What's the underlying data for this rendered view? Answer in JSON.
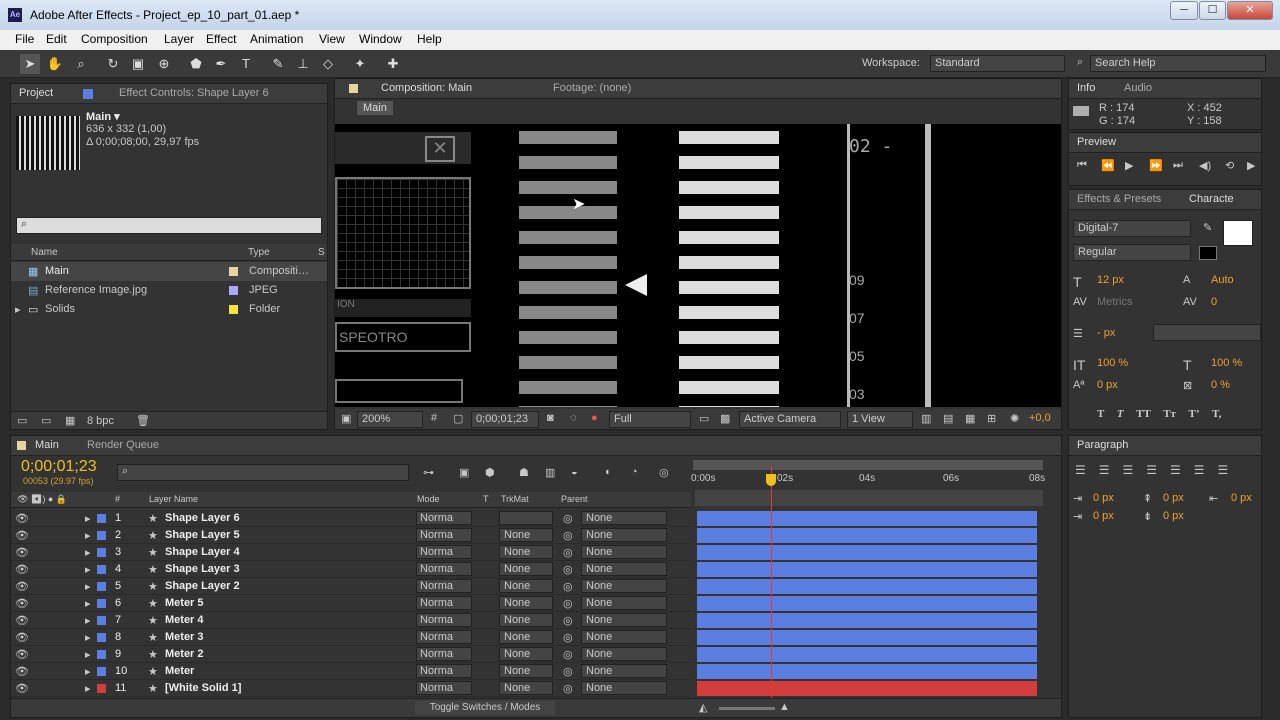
{
  "window": {
    "title": "Adobe After Effects - Project_ep_10_part_01.aep *",
    "app_icon": "Ae",
    "minimize": "─",
    "maximize": "☐",
    "close": "✕"
  },
  "menu": [
    "File",
    "Edit",
    "Composition",
    "Layer",
    "Effect",
    "Animation",
    "View",
    "Window",
    "Help"
  ],
  "toolbar": {
    "workspace_label": "Workspace:",
    "workspace_value": "Standard",
    "search_placeholder": "Search Help"
  },
  "project": {
    "tab": "Project",
    "effect_tab": "Effect Controls: Shape Layer 6",
    "comp_name": "Main ▾",
    "comp_size": "636 x 332 (1,00)",
    "comp_duration": "Δ 0;00;08;00, 29,97 fps",
    "col_name": "Name",
    "col_type": "Type",
    "col_s": "S",
    "items": [
      {
        "name": "Main",
        "type": "Compositi…",
        "color": "#e8d49c"
      },
      {
        "name": "Reference Image.jpg",
        "type": "JPEG",
        "color": "#a9a9ff"
      },
      {
        "name": "Solids",
        "type": "Folder",
        "color": "#f5e33c"
      }
    ],
    "bpc": "8 bpc"
  },
  "composition": {
    "tab": "Composition: Main",
    "footage_tab": "Footage: (none)",
    "subtab": "Main",
    "zoom": "200%",
    "timecode": "0;00;01;23",
    "resolution": "Full",
    "camera": "Active Camera",
    "views": "1 View",
    "exposure": "+0,0",
    "hud": {
      "num_top": "02 -",
      "n09": "09",
      "n07": "07",
      "n05": "05",
      "n03": "03",
      "spectro": "SPEOTRO",
      "ion": "ION"
    }
  },
  "info": {
    "tab": "Info",
    "audio_tab": "Audio",
    "r": "R : 174",
    "g": "G : 174",
    "x": "X : 452",
    "y": "Y : 158"
  },
  "preview": {
    "tab": "Preview"
  },
  "character": {
    "tab1": "Effects & Presets",
    "tab2": "Characte",
    "font": "Digital-7",
    "style": "Regular",
    "size": "12 px",
    "leading": "Auto",
    "kerning": "Metrics",
    "tracking": "0",
    "stroke": "- px",
    "vscale": "100 %",
    "hscale": "100 %",
    "baseline": "0 px",
    "tsume": "0 %"
  },
  "paragraph": {
    "tab": "Paragraph",
    "indent": [
      "0 px",
      "0 px",
      "0 px",
      "0 px",
      "0 px"
    ]
  },
  "timeline": {
    "tab": "Main",
    "render_tab": "Render Queue",
    "timecode": "0;00;01;23",
    "frames": "00053 (29.97 fps)",
    "cols": {
      "num": "#",
      "name": "Layer Name",
      "mode": "Mode",
      "t": "T",
      "trkmat": "TrkMat",
      "parent": "Parent"
    },
    "ruler": [
      "0:00s",
      "02s",
      "04s",
      "06s",
      "08s"
    ],
    "toggle": "Toggle Switches / Modes",
    "layers": [
      {
        "num": "1",
        "name": "Shape Layer 6",
        "mode": "Norma",
        "trk": "",
        "parent": "None",
        "color": "#5b7fe0"
      },
      {
        "num": "2",
        "name": "Shape Layer 5",
        "mode": "Norma",
        "trk": "None",
        "parent": "None",
        "color": "#5b7fe0"
      },
      {
        "num": "3",
        "name": "Shape Layer 4",
        "mode": "Norma",
        "trk": "None",
        "parent": "None",
        "color": "#5b7fe0"
      },
      {
        "num": "4",
        "name": "Shape Layer 3",
        "mode": "Norma",
        "trk": "None",
        "parent": "None",
        "color": "#5b7fe0"
      },
      {
        "num": "5",
        "name": "Shape Layer 2",
        "mode": "Norma",
        "trk": "None",
        "parent": "None",
        "color": "#5b7fe0"
      },
      {
        "num": "6",
        "name": "Meter 5",
        "mode": "Norma",
        "trk": "None",
        "parent": "None",
        "color": "#5b7fe0"
      },
      {
        "num": "7",
        "name": "Meter 4",
        "mode": "Norma",
        "trk": "None",
        "parent": "None",
        "color": "#5b7fe0"
      },
      {
        "num": "8",
        "name": "Meter 3",
        "mode": "Norma",
        "trk": "None",
        "parent": "None",
        "color": "#5b7fe0"
      },
      {
        "num": "9",
        "name": "Meter 2",
        "mode": "Norma",
        "trk": "None",
        "parent": "None",
        "color": "#5b7fe0"
      },
      {
        "num": "10",
        "name": "Meter",
        "mode": "Norma",
        "trk": "None",
        "parent": "None",
        "color": "#5b7fe0"
      },
      {
        "num": "11",
        "name": "[White Solid 1]",
        "mode": "Norma",
        "trk": "None",
        "parent": "None",
        "color": "#d23c3c"
      }
    ]
  }
}
